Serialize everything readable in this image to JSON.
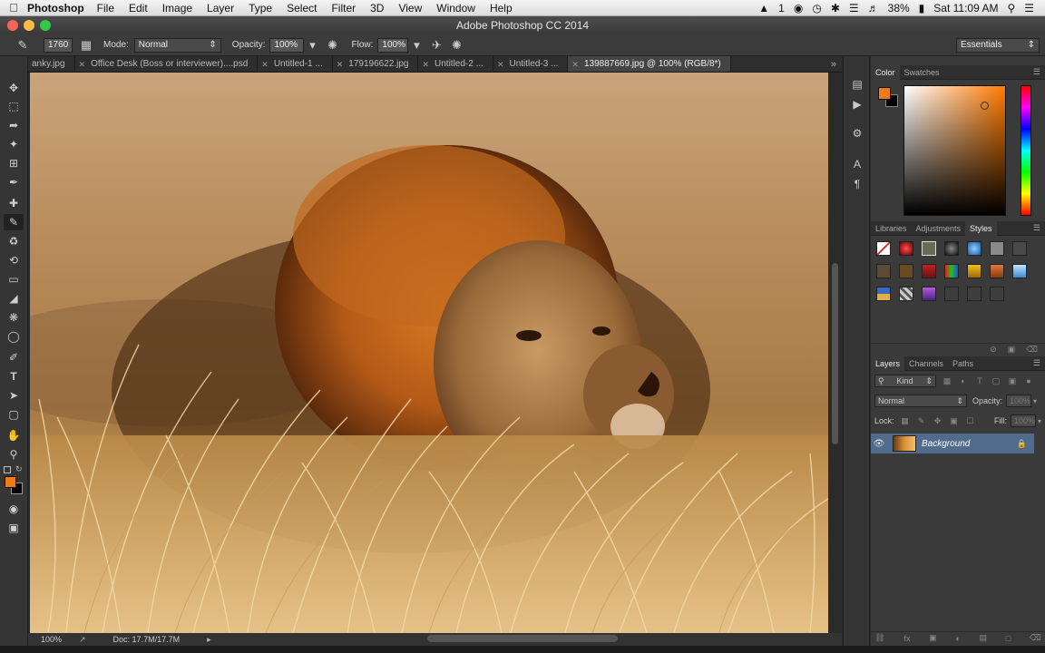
{
  "menubar": {
    "app_name": "Photoshop",
    "menus": [
      "File",
      "Edit",
      "Image",
      "Layer",
      "Type",
      "Select",
      "Filter",
      "3D",
      "View",
      "Window",
      "Help"
    ],
    "battery": "38%",
    "clock": "Sat 11:09 AM",
    "notification_count": "1"
  },
  "window": {
    "title": "Adobe Photoshop CC 2014"
  },
  "options": {
    "brush_size": "1760",
    "mode_label": "Mode:",
    "mode_value": "Normal",
    "opacity_label": "Opacity:",
    "opacity_value": "100%",
    "flow_label": "Flow:",
    "flow_value": "100%",
    "workspace": "Essentials"
  },
  "tabs": [
    {
      "label": "anky.jpg",
      "active": false
    },
    {
      "label": "Office Desk (Boss or interviewer)....psd",
      "active": false
    },
    {
      "label": "Untitled-1 ...",
      "active": false
    },
    {
      "label": "179196622.jpg",
      "active": false
    },
    {
      "label": "Untitled-2 ...",
      "active": false
    },
    {
      "label": "Untitled-3 ...",
      "active": false
    },
    {
      "label": "139887669.jpg @ 100% (RGB/8*)",
      "active": true
    }
  ],
  "status": {
    "zoom": "100%",
    "doc": "Doc: 17.7M/17.7M"
  },
  "color_panel": {
    "tabs": [
      "Color",
      "Swatches"
    ],
    "foreground": "#ee7a1a",
    "background": "#000000"
  },
  "styles_panel": {
    "tabs": [
      "Libraries",
      "Adjustments",
      "Styles"
    ]
  },
  "layers_panel": {
    "tabs": [
      "Layers",
      "Channels",
      "Paths"
    ],
    "filter_kind": "Kind",
    "blend_mode": "Normal",
    "opacity_label": "Opacity:",
    "opacity_value": "100%",
    "lock_label": "Lock:",
    "fill_label": "Fill:",
    "fill_value": "100%",
    "layers": [
      {
        "name": "Background"
      }
    ]
  },
  "icons": {
    "tools": [
      "move-icon",
      "marquee-icon",
      "lasso-icon",
      "magic-wand-icon",
      "crop-icon",
      "eyedropper-icon",
      "healing-icon",
      "brush-icon",
      "clone-stamp-icon",
      "history-brush-icon",
      "eraser-icon",
      "gradient-icon",
      "blur-icon",
      "dodge-icon",
      "pen-icon",
      "type-icon",
      "path-select-icon",
      "rectangle-icon",
      "hand-icon",
      "zoom-icon"
    ]
  }
}
